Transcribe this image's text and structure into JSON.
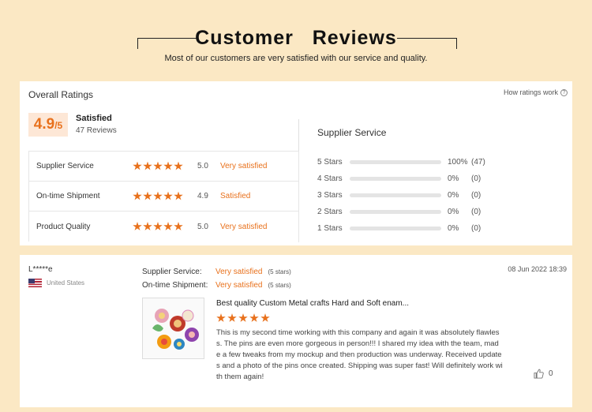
{
  "header": {
    "title": "Customer  Reviews",
    "subtitle": "Most of our customers are very satisfied with our service and quality."
  },
  "overall": {
    "label": "Overall Ratings",
    "how_ratings": "How ratings work",
    "score": "4.9",
    "score_suffix": "/5",
    "status": "Satisfied",
    "review_count": "47 Reviews",
    "rows": [
      {
        "label": "Supplier Service",
        "score": "5.0",
        "desc": "Very satisfied",
        "stars": 5
      },
      {
        "label": "On-time Shipment",
        "score": "4.9",
        "desc": "Satisfied",
        "stars": 5
      },
      {
        "label": "Product Quality",
        "score": "5.0",
        "desc": "Very satisfied",
        "stars": 5
      }
    ]
  },
  "supplier_distribution": {
    "title": "Supplier Service",
    "rows": [
      {
        "label": "5 Stars",
        "pct": "100%",
        "count": "(47)",
        "fraction": 1.0
      },
      {
        "label": "4 Stars",
        "pct": "0%",
        "count": "(0)",
        "fraction": 0
      },
      {
        "label": "3 Stars",
        "pct": "0%",
        "count": "(0)",
        "fraction": 0
      },
      {
        "label": "2 Stars",
        "pct": "0%",
        "count": "(0)",
        "fraction": 0
      },
      {
        "label": "1 Stars",
        "pct": "0%",
        "count": "(0)",
        "fraction": 0
      }
    ]
  },
  "review": {
    "reviewer": "L*****e",
    "country": "United States",
    "supplier_service_label": "Supplier Service:",
    "supplier_service_value": "Very satisfied",
    "supplier_service_stars": "(5 stars)",
    "shipment_label": "On-time Shipment:",
    "shipment_value": "Very satisfied",
    "shipment_stars": "(5 stars)",
    "date": "08 Jun 2022 18:39",
    "product_title": "Best quality Custom Metal crafts Hard and Soft enam...",
    "rating": 5,
    "text": "This is my second time working with this company and again it was absolutely flawless. The pins are even more gorgeous in person!!! I shared my idea with the team, made a few tweaks from my mockup and then production was underway. Received updates and a photo of the pins once created. Shipping was super fast! Will definitely work with them again!",
    "likes": "0"
  },
  "colors": {
    "accent": "#e8711c",
    "background": "#fbe8c4",
    "score_bg": "#fde7d6"
  }
}
